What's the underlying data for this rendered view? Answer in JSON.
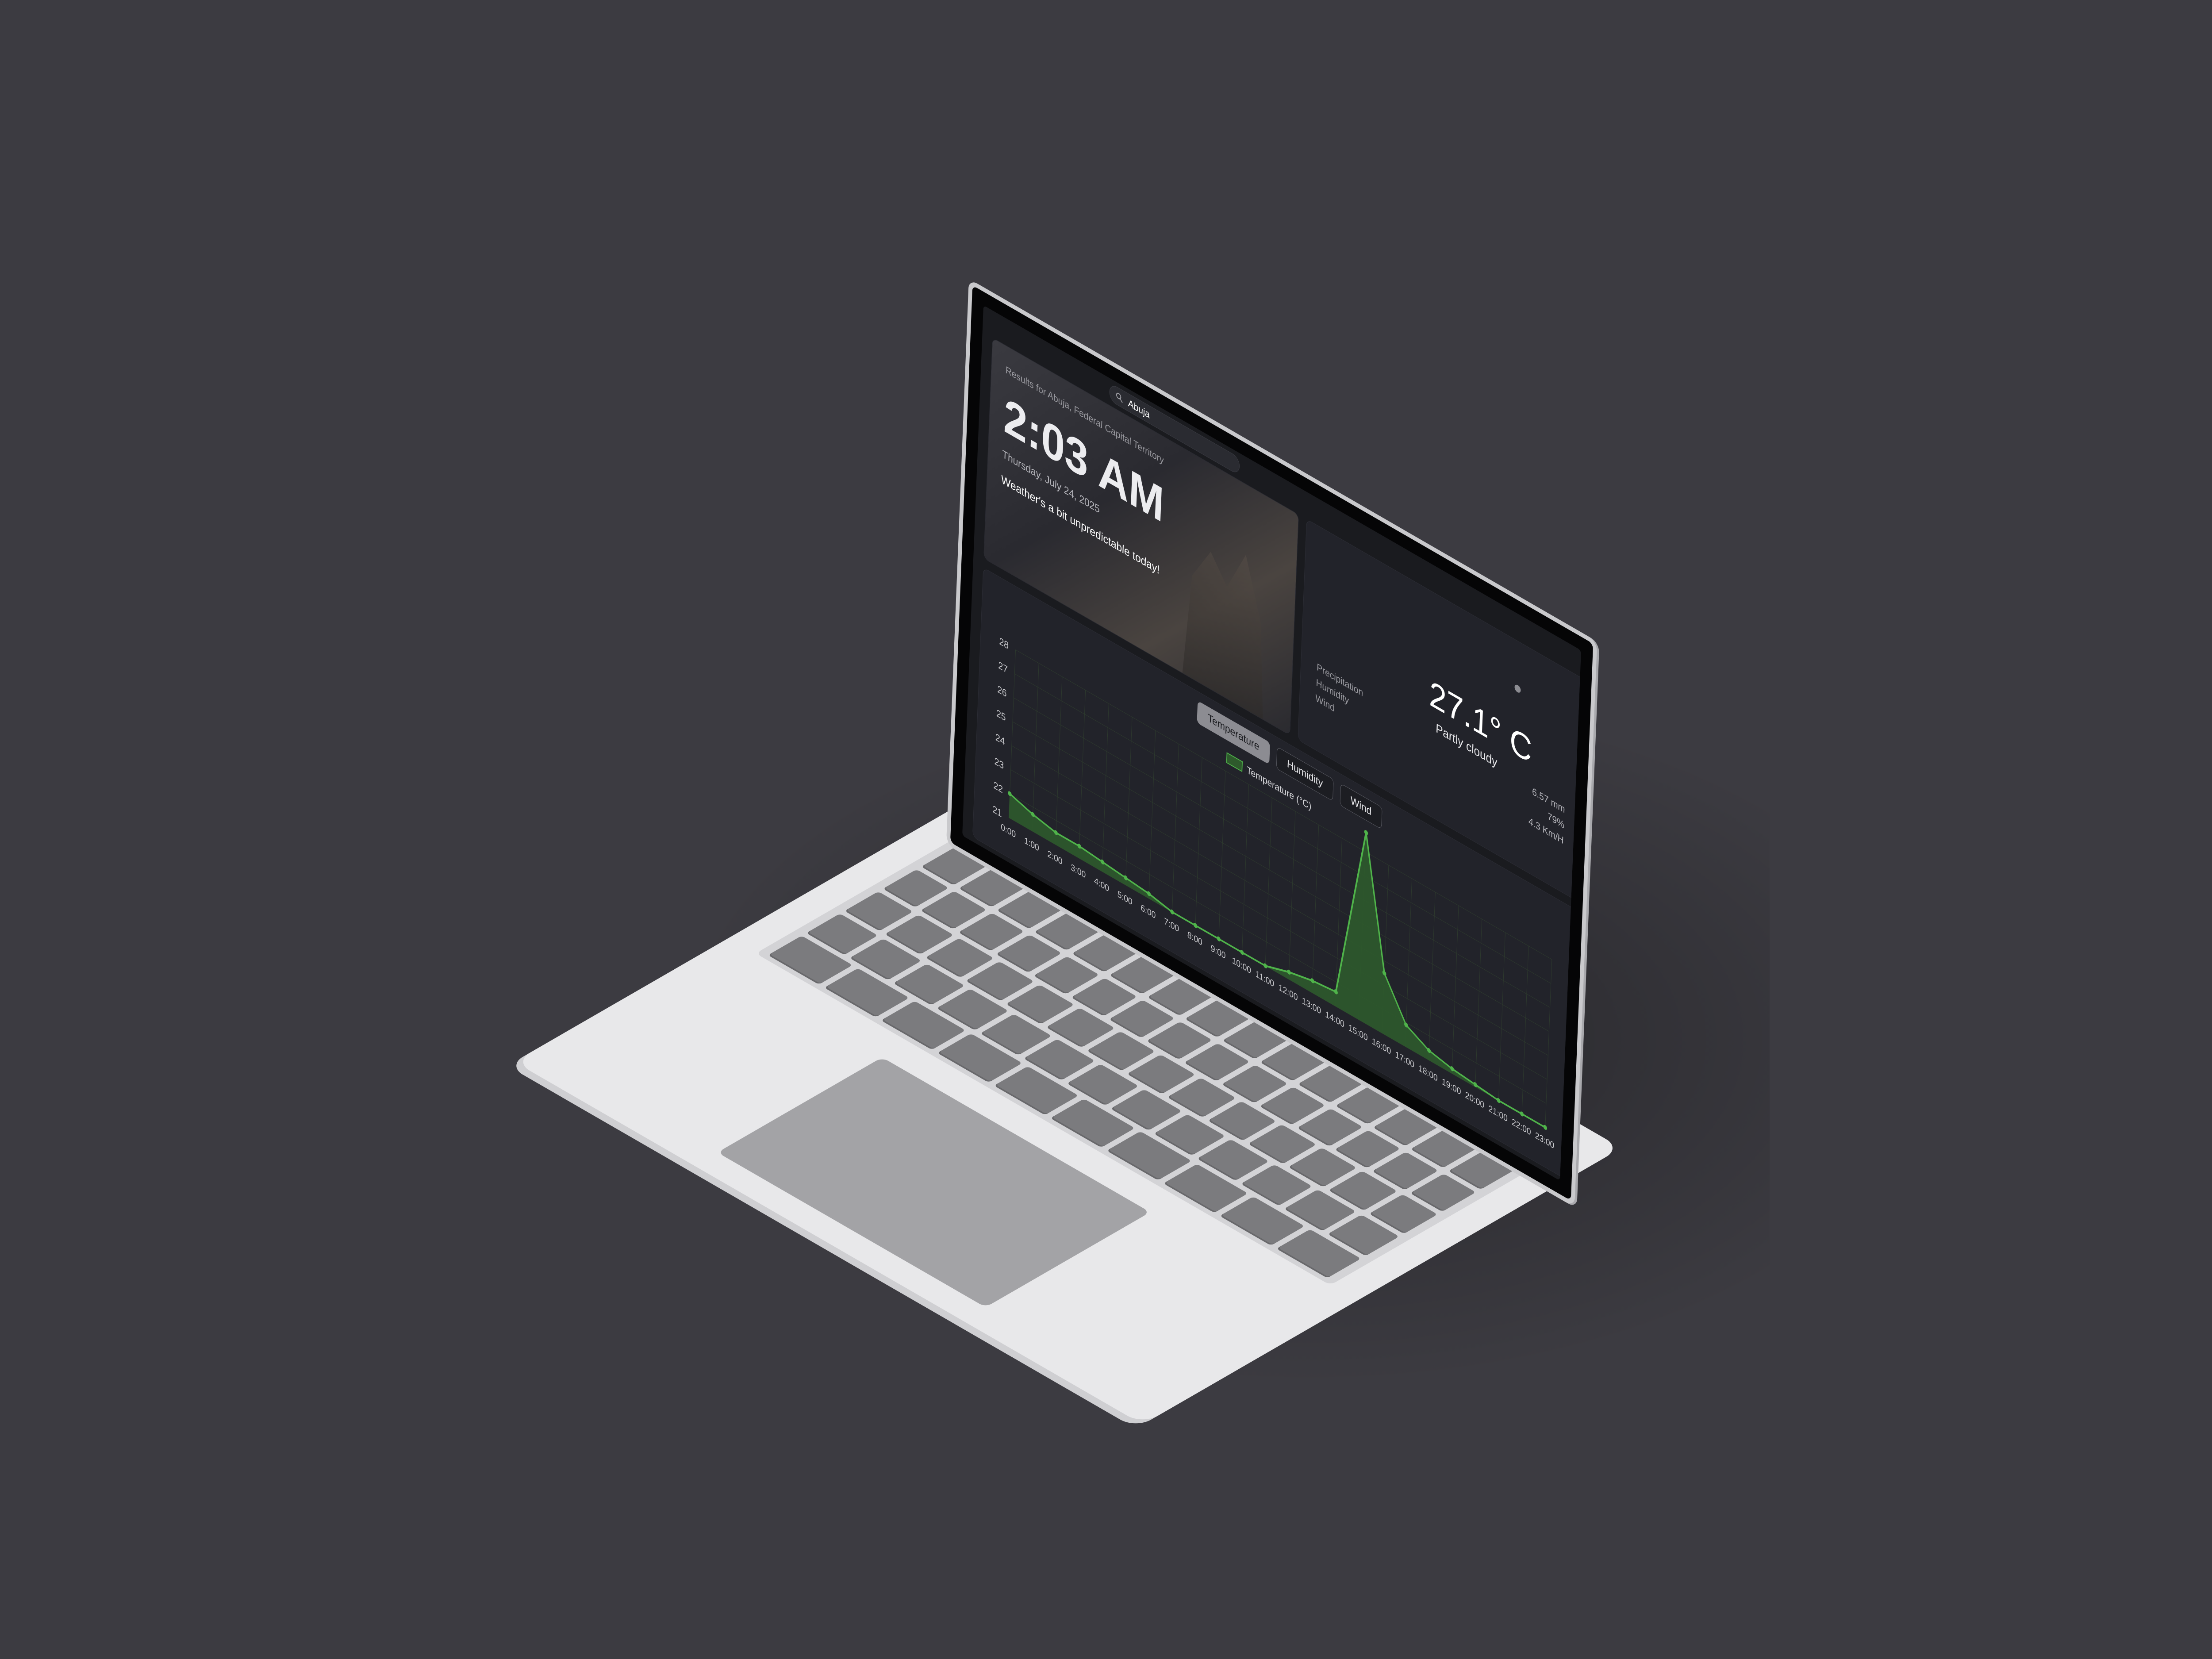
{
  "search": {
    "value": "Abuja",
    "icon": "search-icon"
  },
  "hero": {
    "results_label": "Results for Abuja, Federal Capital Territory",
    "time": "2:03 AM",
    "date": "Thursday, July 24, 2025",
    "message": "Weather's a bit unpredictable today!"
  },
  "current": {
    "temperature": "27.1° C",
    "condition": "Partly cloudy",
    "icon": "sun-icon",
    "stats": [
      {
        "label": "Precipitation",
        "value": "6.57 mm"
      },
      {
        "label": "Humidity",
        "value": "79%"
      },
      {
        "label": "Wind",
        "value": "4.3 Km/H"
      }
    ]
  },
  "tabs": [
    {
      "label": "Temperature",
      "active": true
    },
    {
      "label": "Humidity",
      "active": false
    },
    {
      "label": "Wind",
      "active": false
    }
  ],
  "colors": {
    "accent": "#4fb34a",
    "accent_fill": "#2e5a2c",
    "background": "#1a1b1f"
  },
  "chart_data": {
    "type": "area",
    "legend": [
      "Temperature (°C)"
    ],
    "x": [
      "0:00",
      "1:00",
      "2:00",
      "3:00",
      "4:00",
      "5:00",
      "6:00",
      "7:00",
      "8:00",
      "9:00",
      "10:00",
      "11:00",
      "12:00",
      "13:00",
      "14:00",
      "15:00",
      "16:00",
      "17:00",
      "18:00",
      "19:00",
      "20:00",
      "21:00",
      "22:00",
      "23:00"
    ],
    "series": [
      {
        "name": "Temperature (°C)",
        "values": [
          22,
          21.7,
          21.5,
          21.5,
          21.4,
          21.3,
          21.2,
          21,
          21,
          21,
          21,
          21,
          21.3,
          21.5,
          21.6,
          28.8,
          23.5,
          21.9,
          21.4,
          21.2,
          21.1,
          21,
          21,
          21
        ]
      }
    ],
    "yticks": [
      21,
      22,
      23,
      24,
      25,
      26,
      27,
      28
    ],
    "ylim": [
      21,
      28
    ],
    "grid": true,
    "legend_position": "top-center"
  }
}
